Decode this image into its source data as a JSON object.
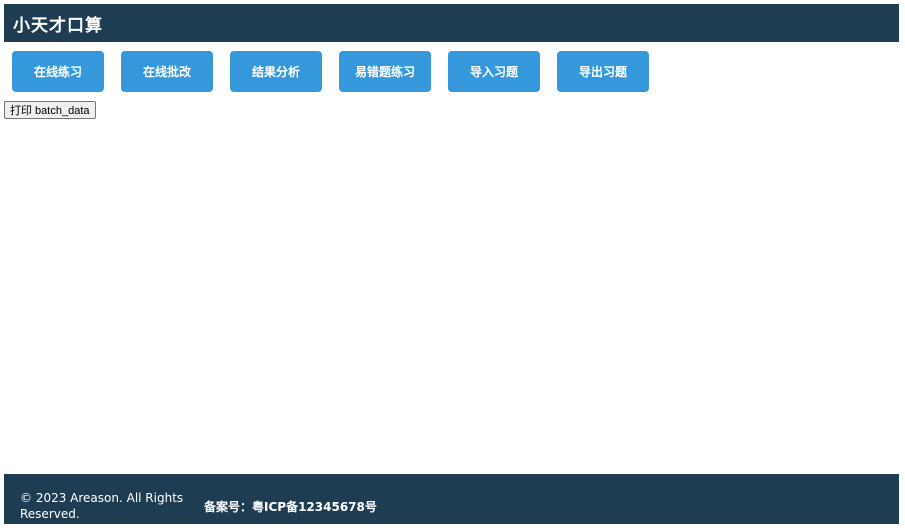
{
  "header": {
    "title": "小天才口算"
  },
  "nav": {
    "items": [
      {
        "label": "在线练习"
      },
      {
        "label": "在线批改"
      },
      {
        "label": "结果分析"
      },
      {
        "label": "易错题练习"
      },
      {
        "label": "导入习题"
      },
      {
        "label": "导出习题"
      }
    ]
  },
  "print_button": {
    "label": "打印 batch_data"
  },
  "footer": {
    "copyright": "© 2023 Areason. All Rights Reserved.",
    "icp": "备案号：粤ICP备12345678号"
  },
  "colors": {
    "header_bg": "#1f3d52",
    "button_bg": "#3498db",
    "text_on_dark": "#ffffff"
  }
}
